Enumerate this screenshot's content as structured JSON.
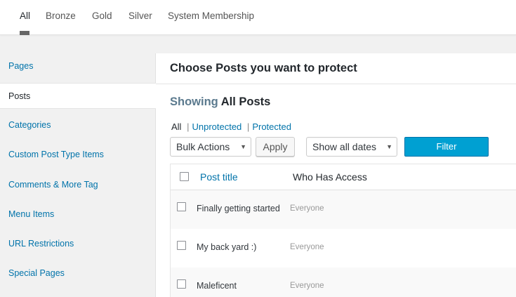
{
  "tabs": [
    {
      "label": "All",
      "active": true
    },
    {
      "label": "Bronze"
    },
    {
      "label": "Gold"
    },
    {
      "label": "Silver"
    },
    {
      "label": "System Membership"
    }
  ],
  "sidebar": {
    "items": [
      {
        "label": "Pages"
      },
      {
        "label": "Posts",
        "active": true
      },
      {
        "label": "Categories"
      },
      {
        "label": "Custom Post Type Items"
      },
      {
        "label": "Comments & More Tag"
      },
      {
        "label": "Menu Items"
      },
      {
        "label": "URL Restrictions"
      },
      {
        "label": "Special Pages"
      }
    ]
  },
  "main": {
    "title": "Choose Posts you want to protect",
    "showing_lead": "Showing",
    "showing_target": "All Posts",
    "sublinks": {
      "all": "All",
      "unprotected": "Unprotected",
      "protected": "Protected",
      "separator": "|"
    },
    "controls": {
      "bulk_actions": "Bulk Actions",
      "apply": "Apply",
      "dates": "Show all dates",
      "filter": "Filter"
    },
    "table": {
      "headers": {
        "title": "Post title",
        "access": "Who Has Access"
      },
      "rows": [
        {
          "title": "Finally getting started",
          "access": "Everyone"
        },
        {
          "title": "My back yard :)",
          "access": "Everyone"
        },
        {
          "title": "Maleficent",
          "access": "Everyone"
        }
      ]
    }
  },
  "colors": {
    "link": "#0073aa",
    "primary_button": "#00a0d2",
    "text": "#23282d",
    "muted": "#999999"
  }
}
